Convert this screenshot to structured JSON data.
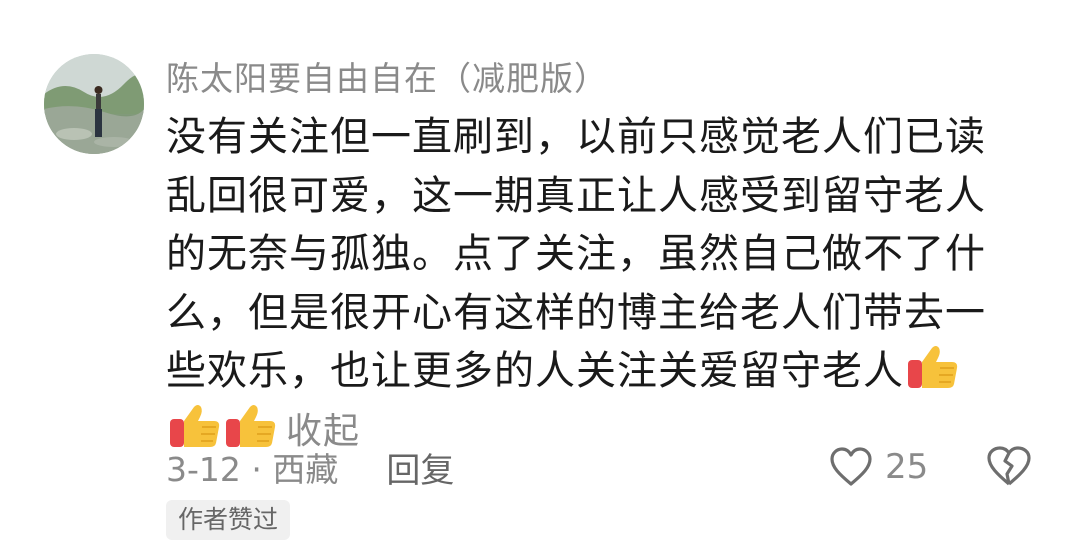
{
  "comment": {
    "username": "陈太阳要自由自在（减肥版）",
    "text": "没有关注但一直刷到，以前只感觉老人们已读乱回很可爱，这一期真正让人感受到留守老人的无奈与孤独。点了关注，虽然自己做不了什么，但是很开心有这样的博主给老人们带去一些欢乐，也让更多的人关注关爱留守老人",
    "emoji_icons": [
      "thumbs-up-icon",
      "thumbs-up-icon",
      "thumbs-up-icon"
    ],
    "collapse_label": "收起",
    "date_location": "3-12 · 西藏",
    "reply_label": "回复",
    "like_count": "25",
    "author_badge": "作者赞过"
  },
  "colors": {
    "secondary_text": "#8a8a8a",
    "primary_text": "#1a1a1a",
    "badge_bg": "#f0f0f0",
    "thumb_yellow": "#f7c23b",
    "thumb_red": "#e8464a"
  }
}
